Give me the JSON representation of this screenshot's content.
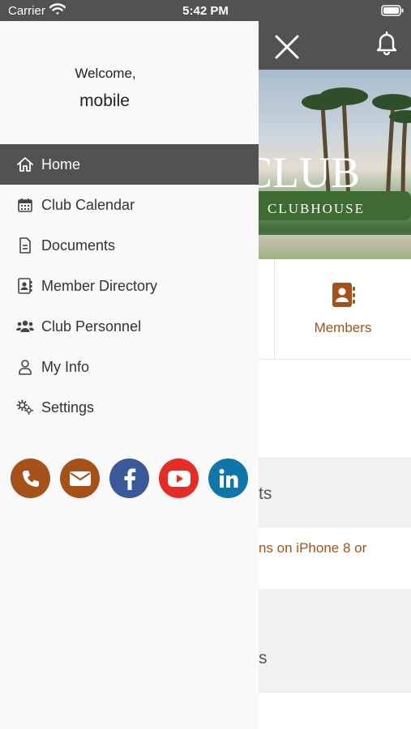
{
  "status_bar": {
    "carrier": "Carrier",
    "time": "5:42 PM"
  },
  "drawer": {
    "welcome": "Welcome,",
    "username": "mobile",
    "nav_items": [
      {
        "label": "Home",
        "icon": "home-icon",
        "active": true
      },
      {
        "label": "Club Calendar",
        "icon": "calendar-icon",
        "active": false
      },
      {
        "label": "Documents",
        "icon": "document-icon",
        "active": false
      },
      {
        "label": "Member Directory",
        "icon": "contact-book-icon",
        "active": false
      },
      {
        "label": "Club Personnel",
        "icon": "people-icon",
        "active": false
      },
      {
        "label": "My Info",
        "icon": "user-icon",
        "active": false
      },
      {
        "label": "Settings",
        "icon": "gears-icon",
        "active": false
      }
    ],
    "social": [
      {
        "name": "phone",
        "icon": "phone-icon",
        "color": "#a4521a"
      },
      {
        "name": "email",
        "icon": "envelope-icon",
        "color": "#a4521a"
      },
      {
        "name": "facebook",
        "icon": "facebook-icon",
        "color": "#3b5998"
      },
      {
        "name": "youtube",
        "icon": "youtube-icon",
        "color": "#e52d27"
      },
      {
        "name": "linkedin",
        "icon": "linkedin-icon",
        "color": "#0e76a8"
      }
    ]
  },
  "background_app": {
    "hero_title": "CLUB",
    "hero_subtitle": "CLUBHOUSE",
    "tile_members_label": "Members",
    "section_1_fragment": "ts",
    "notice_fragment": "ns on iPhone 8 or",
    "section_2_fragment": "s"
  },
  "colors": {
    "header_bg": "#525252",
    "accent": "#a4521a",
    "drawer_bg": "#f9f9f9"
  }
}
